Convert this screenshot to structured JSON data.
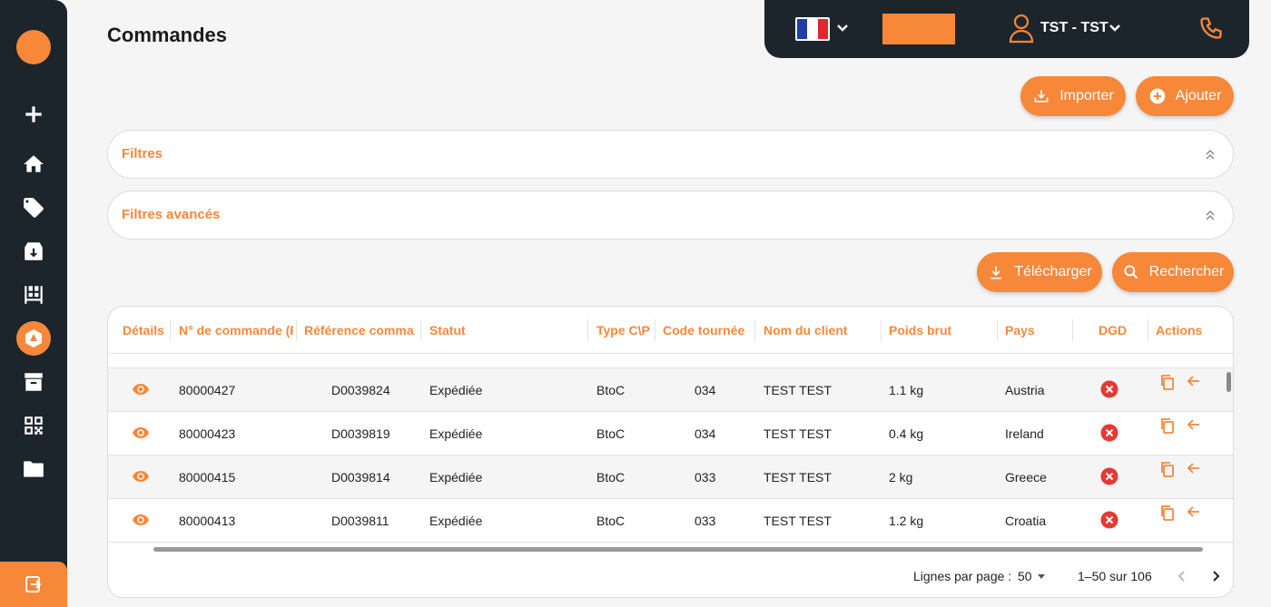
{
  "page": {
    "title": "Commandes"
  },
  "topbar": {
    "user_name": "TST - TST",
    "flag": "france-flag"
  },
  "actions": {
    "import_label": "Importer",
    "add_label": "Ajouter",
    "download_label": "Télécharger",
    "search_label": "Rechercher"
  },
  "filters": {
    "basic_label": "Filtres",
    "advanced_label": "Filtres avancés"
  },
  "sidebar": {
    "icons": [
      "plus-icon",
      "home-icon",
      "tag-icon",
      "download-box-icon",
      "pallet-icon",
      "logo-active-icon",
      "archive-icon",
      "qr-code-icon",
      "folder-icon"
    ],
    "logout_icon": "logout-icon"
  },
  "table": {
    "columns": [
      "Détails",
      "N° de commande (R)",
      "Référence comma...",
      "Statut",
      "Type C\\P",
      "Code tournée",
      "Nom du client",
      "Poids brut",
      "Pays",
      "DGD",
      "Actions"
    ],
    "rows": [
      {
        "order": "80000427",
        "ref": "D0039824",
        "status": "Expédiée",
        "type": "BtoC",
        "route": "034",
        "client": "TEST TEST",
        "weight": "1.1 kg",
        "country": "Austria"
      },
      {
        "order": "80000423",
        "ref": "D0039819",
        "status": "Expédiée",
        "type": "BtoC",
        "route": "034",
        "client": "TEST TEST",
        "weight": "0.4 kg",
        "country": "Ireland"
      },
      {
        "order": "80000415",
        "ref": "D0039814",
        "status": "Expédiée",
        "type": "BtoC",
        "route": "033",
        "client": "TEST TEST",
        "weight": "2 kg",
        "country": "Greece"
      },
      {
        "order": "80000413",
        "ref": "D0039811",
        "status": "Expédiée",
        "type": "BtoC",
        "route": "033",
        "client": "TEST TEST",
        "weight": "1.2 kg",
        "country": "Croatia"
      }
    ]
  },
  "pagination": {
    "rows_label": "Lignes par page :",
    "rows_value": "50",
    "range": "1–50 sur 106"
  },
  "colors": {
    "accent": "#f7883a",
    "dark": "#1d252c",
    "danger": "#e53935"
  }
}
